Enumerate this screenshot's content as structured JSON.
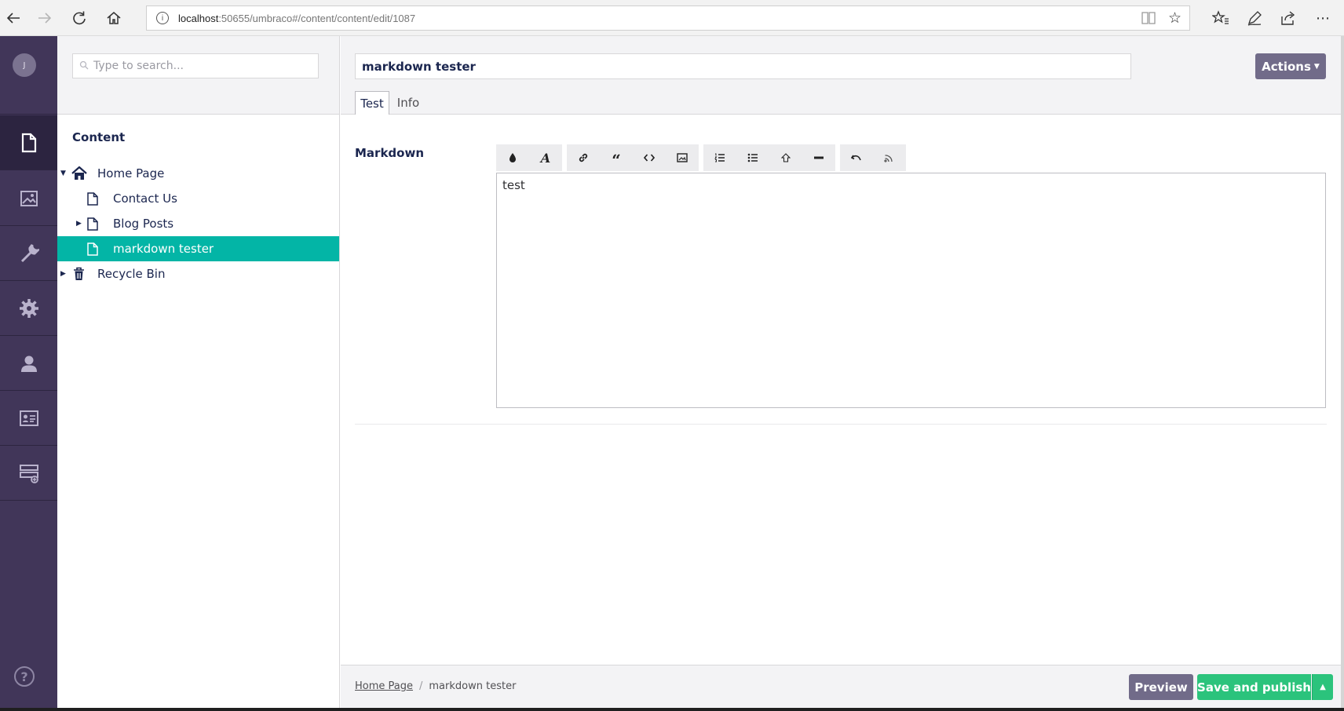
{
  "browser": {
    "url_host": "localhost",
    "url_path": ":50655/umbraco#/content/content/edit/1087",
    "icons": [
      "back-icon",
      "forward-icon",
      "refresh-icon",
      "home-icon",
      "info-icon",
      "reading-view-icon",
      "favorite-star-icon",
      "favorites-icon",
      "pen-icon",
      "share-icon",
      "more-icon"
    ]
  },
  "user": {
    "initial": "J"
  },
  "sections": [
    "content",
    "media",
    "settings-tools",
    "developer",
    "users",
    "members",
    "forms"
  ],
  "search": {
    "placeholder": "Type to search..."
  },
  "tree": {
    "title": "Content",
    "nodes": [
      {
        "label": "Home Page",
        "icon": "home-icon",
        "expanded": true
      },
      {
        "label": "Contact Us",
        "icon": "document-icon"
      },
      {
        "label": "Blog Posts",
        "icon": "document-icon",
        "expanded": false
      },
      {
        "label": "markdown tester",
        "icon": "document-icon",
        "selected": true
      },
      {
        "label": "Recycle Bin",
        "icon": "trash-icon",
        "expanded": false
      }
    ]
  },
  "editor": {
    "name": "markdown tester",
    "actions_label": "Actions",
    "tabs": [
      {
        "label": "Test",
        "active": true
      },
      {
        "label": "Info",
        "active": false
      }
    ],
    "property_label": "Markdown",
    "markdown_value": "test",
    "toolbar_icons": [
      "bold-icon",
      "italic-icon",
      "link-icon",
      "blockquote-icon",
      "code-icon",
      "image-icon",
      "ordered-list-icon",
      "unordered-list-icon",
      "heading-icon",
      "horizontal-rule-icon",
      "undo-icon",
      "redo-icon"
    ]
  },
  "footer": {
    "breadcrumb": [
      "Home Page",
      "markdown tester"
    ],
    "preview_label": "Preview",
    "publish_label": "Save and publish"
  },
  "colors": {
    "appnav": "#413659",
    "selected": "#03b5a6",
    "actions": "#716b89",
    "publish": "#2bc37c"
  }
}
